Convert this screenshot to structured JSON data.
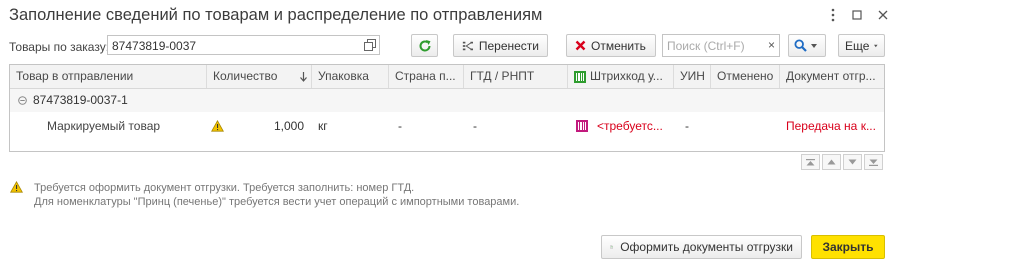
{
  "window": {
    "title": "Заполнение сведений по товарам и распределение по отправлениям"
  },
  "toolbar": {
    "order_label": "Товары по заказу:",
    "order_value": "87473819-0037",
    "transfer_label": "Перенести",
    "cancel_label": "Отменить",
    "search_placeholder": "Поиск (Ctrl+F)",
    "more_label": "Еще"
  },
  "table": {
    "headers": {
      "goods": "Товар в отправлении",
      "quantity": "Количество",
      "package": "Упаковка",
      "country": "Страна п...",
      "gtd": "ГТД / РНПТ",
      "barcode": "Штрихкод у...",
      "uin": "УИН",
      "cancelled": "Отменено",
      "document": "Документ отгр..."
    },
    "group_row": {
      "name": "87473819-0037-1"
    },
    "item_row": {
      "goods": "Маркируемый товар",
      "quantity": "1,000",
      "package": "кг",
      "country": "-",
      "gtd": "-",
      "barcode": "<требуетс...",
      "uin": "-",
      "document": "Передача на к..."
    }
  },
  "messages": {
    "line1": "Требуется оформить документ отгрузки. Требуется заполнить: номер ГТД.",
    "line2": "Для номенклатуры \"Принц (печенье)\" требуется вести учет операций с импортными товарами."
  },
  "footer": {
    "create_docs_label": "Оформить документы отгрузки",
    "close_label": "Закрыть"
  },
  "colors": {
    "accent_yellow": "#ffe100",
    "warning_red": "#d9001b",
    "refresh_green": "#2e9c2e",
    "barcode_magenta": "#c21a7d",
    "search_blue": "#1f6cc4"
  }
}
